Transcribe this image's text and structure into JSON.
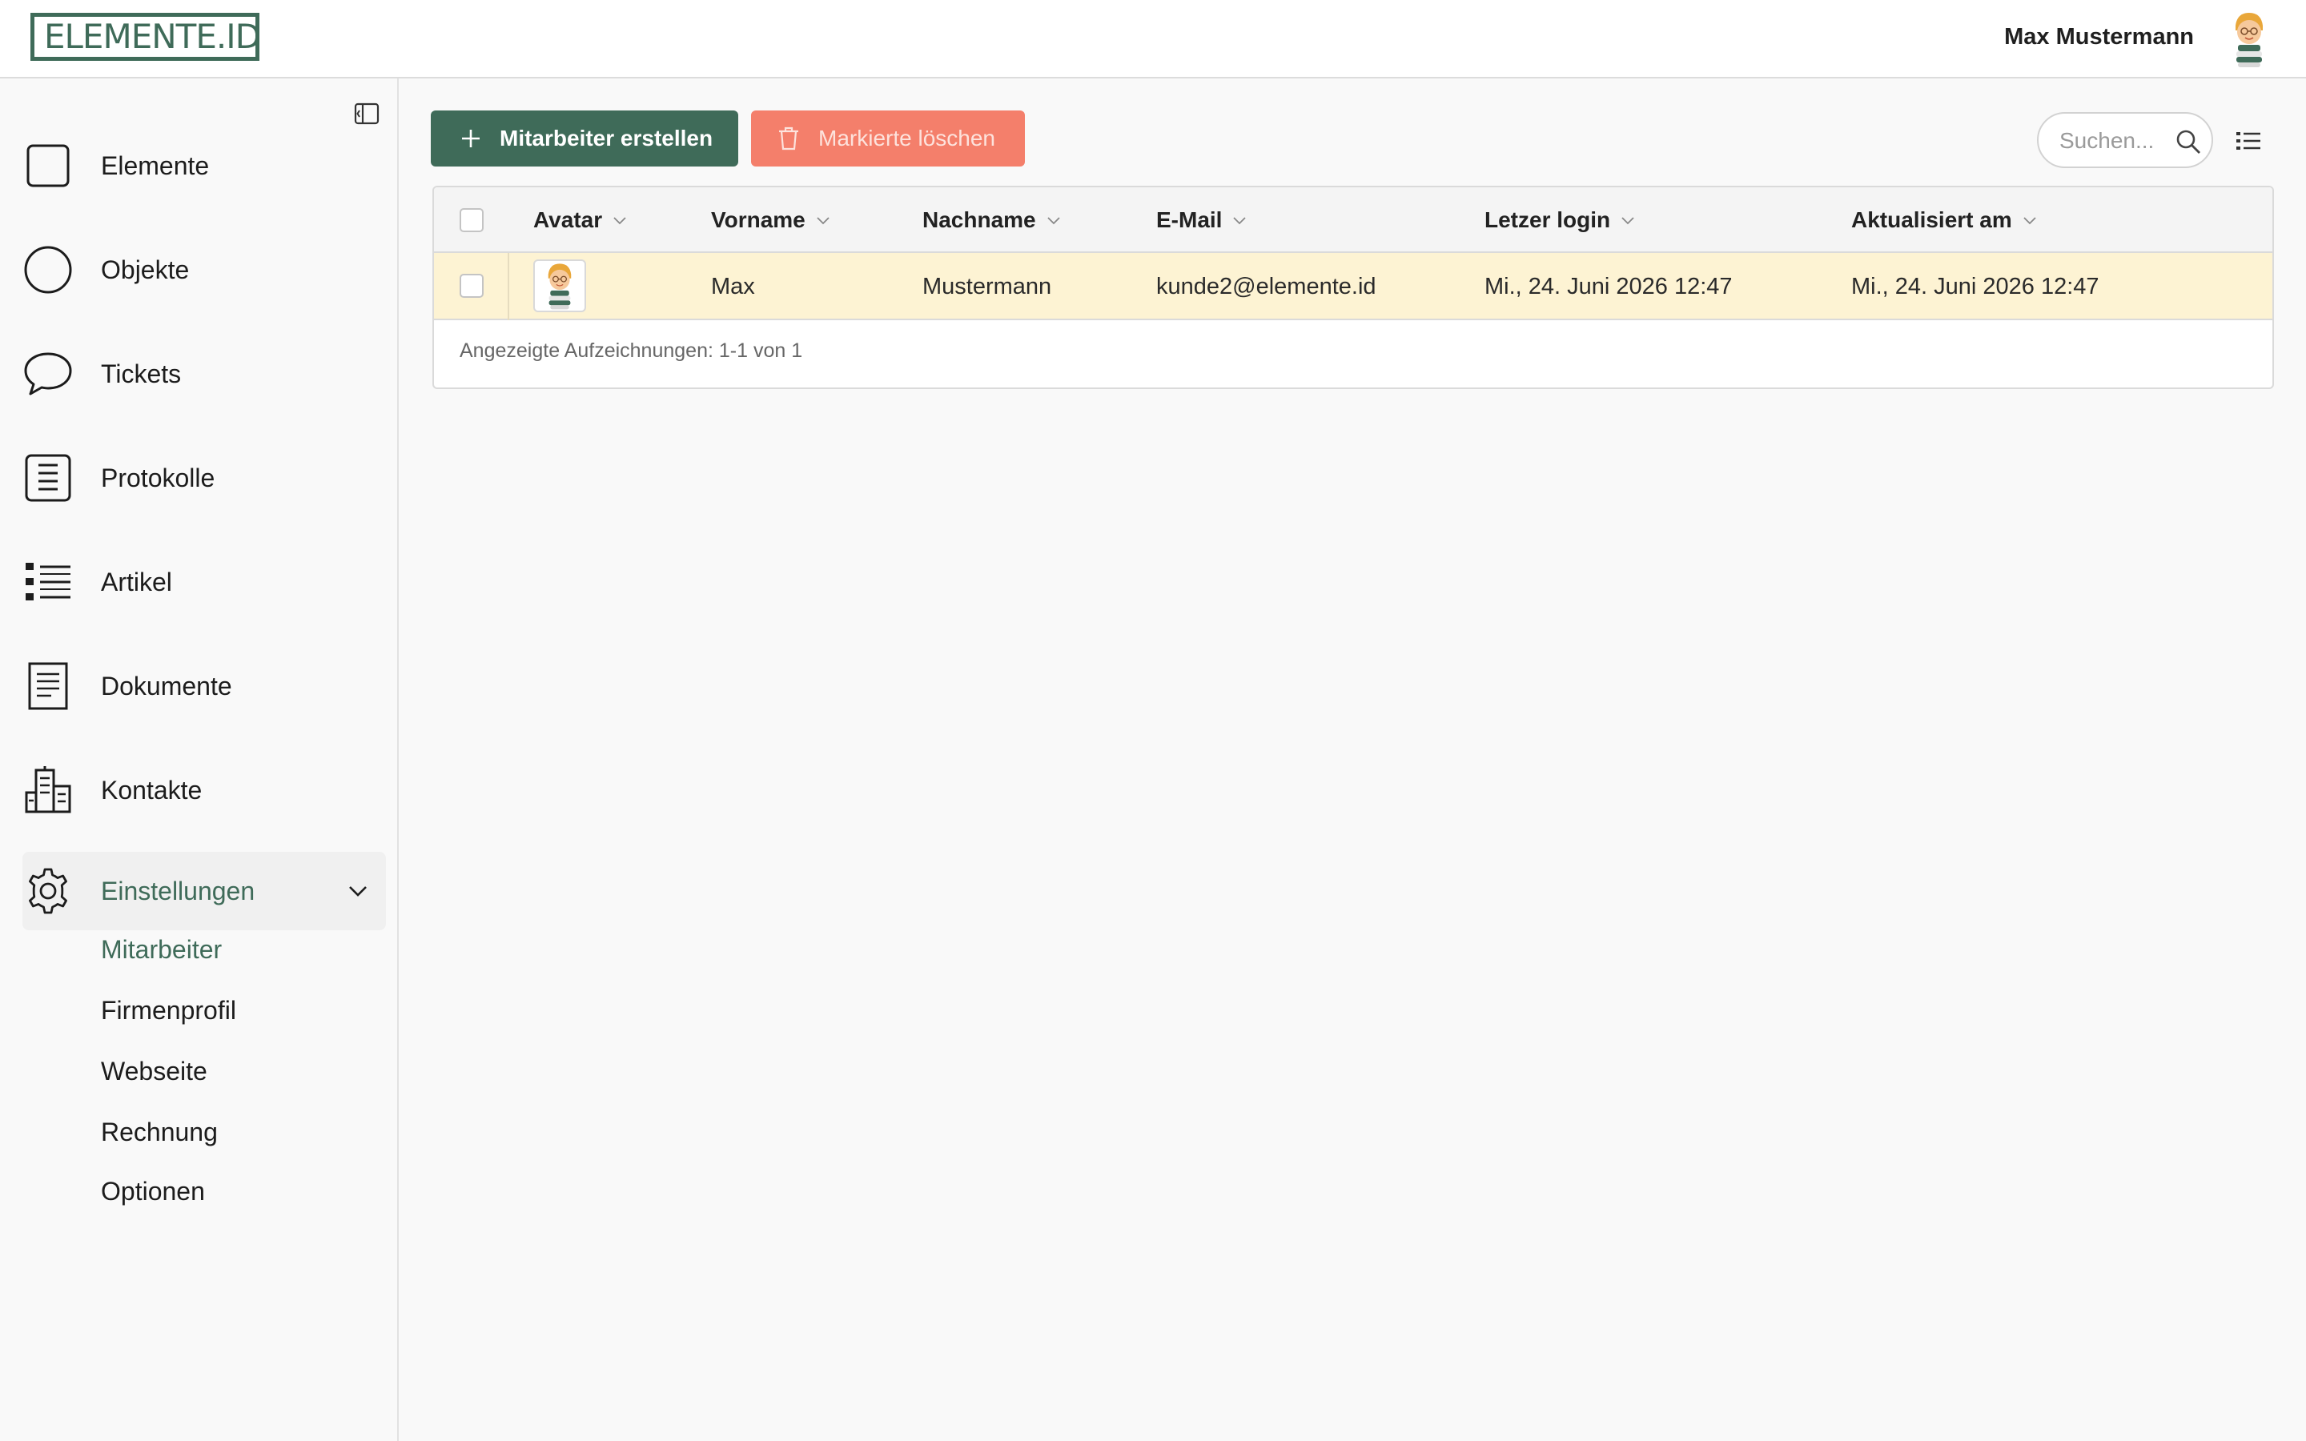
{
  "header": {
    "logo_text": "ELEMENTE.ID",
    "user_name": "Max Mustermann",
    "avatar_icon": "user-avatar-icon"
  },
  "sidebar": {
    "items": [
      {
        "label": "Elemente",
        "icon": "square-icon"
      },
      {
        "label": "Objekte",
        "icon": "circle-icon"
      },
      {
        "label": "Tickets",
        "icon": "speech-bubble-icon"
      },
      {
        "label": "Protokolle",
        "icon": "protocol-icon"
      },
      {
        "label": "Artikel",
        "icon": "list-icon"
      },
      {
        "label": "Dokumente",
        "icon": "document-icon"
      },
      {
        "label": "Kontakte",
        "icon": "buildings-icon"
      },
      {
        "label": "Einstellungen",
        "icon": "gear-icon"
      }
    ],
    "subitems": [
      {
        "label": "Mitarbeiter"
      },
      {
        "label": "Firmenprofil"
      },
      {
        "label": "Webseite"
      },
      {
        "label": "Rechnung"
      },
      {
        "label": "Optionen"
      }
    ]
  },
  "toolbar": {
    "create_label": "Mitarbeiter erstellen",
    "delete_label": "Markierte löschen",
    "search_placeholder": "Suchen..."
  },
  "table": {
    "columns": [
      "Avatar",
      "Vorname",
      "Nachname",
      "E-Mail",
      "Letzer login",
      "Aktualisiert am"
    ],
    "rows": [
      {
        "vorname": "Max",
        "nachname": "Mustermann",
        "email": "kunde2@elemente.id",
        "letzter_login": "Mi., 24. Juni 2026 12:47",
        "aktualisiert_am": "Mi., 24. Juni 2026 12:47"
      }
    ],
    "footer": "Angezeigte Aufzeichnungen: 1-1 von 1"
  },
  "colors": {
    "primary": "#3f6b59",
    "danger": "#f47f6b",
    "row_highlight": "#fdf3d3"
  }
}
